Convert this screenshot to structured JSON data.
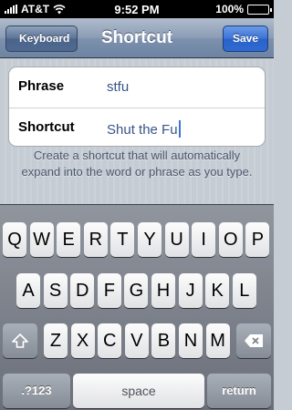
{
  "status_bar": {
    "carrier": "AT&T",
    "time": "9:52 PM",
    "battery": "100%"
  },
  "nav": {
    "back_label": "Keyboard",
    "title": "Shortcut",
    "save_label": "Save"
  },
  "form": {
    "phrase_label": "Phrase",
    "phrase_value": "stfu",
    "shortcut_label": "Shortcut",
    "shortcut_value": "Shut the Fu"
  },
  "footer": {
    "text": "Create a shortcut that will automatically expand into the word or phrase as you type."
  },
  "keyboard": {
    "row1": [
      "Q",
      "W",
      "E",
      "R",
      "T",
      "Y",
      "U",
      "I",
      "O",
      "P"
    ],
    "row2": [
      "A",
      "S",
      "D",
      "F",
      "G",
      "H",
      "J",
      "K",
      "L"
    ],
    "row3": [
      "Z",
      "X",
      "C",
      "V",
      "B",
      "N",
      "M"
    ],
    "numbers": ".?123",
    "space": "space",
    "return": "return",
    "shift_icon": "shift-icon",
    "delete_icon": "delete-icon"
  }
}
